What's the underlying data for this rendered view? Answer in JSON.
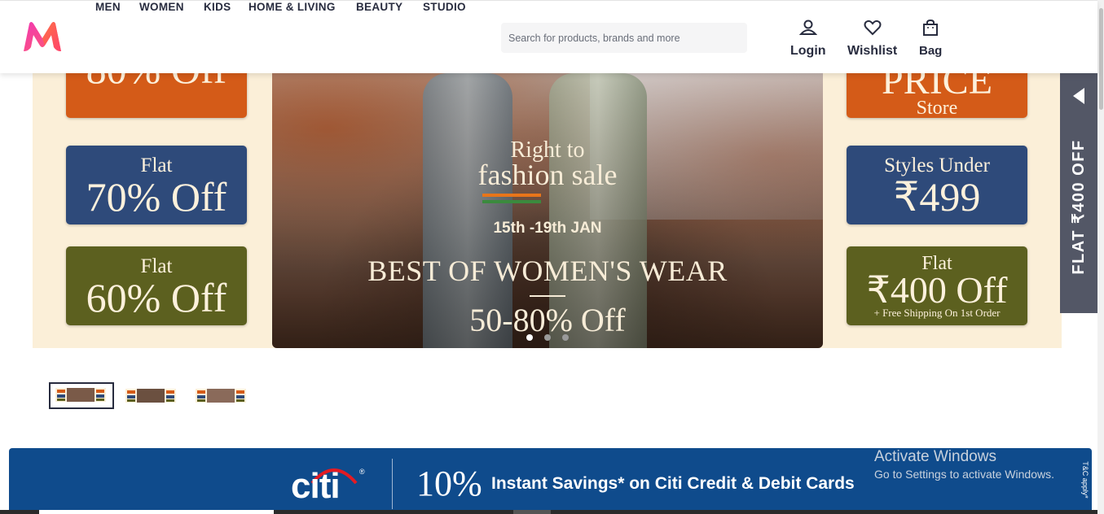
{
  "header": {
    "logo_alt": "Myntra",
    "nav": [
      "MEN",
      "WOMEN",
      "KIDS",
      "HOME & LIVING",
      "BEAUTY",
      "STUDIO"
    ],
    "search_placeholder": "Search for products, brands and more",
    "actions": {
      "login": "Login",
      "wishlist": "Wishlist",
      "bag": "Bag"
    }
  },
  "banner": {
    "left_tiles": [
      {
        "small": "",
        "big": "80% Off",
        "color": "#d45b18"
      },
      {
        "small": "Flat",
        "big": "70% Off",
        "color": "#2e4a7a"
      },
      {
        "small": "Flat",
        "big": "60% Off",
        "color": "#5c601f"
      }
    ],
    "right_tiles": [
      {
        "big": "PRICE",
        "small": "Store",
        "color": "#d45b18"
      },
      {
        "small": "Styles Under",
        "big": "₹499",
        "color": "#2e4a7a"
      },
      {
        "small": "Flat",
        "big": "₹400 Off",
        "tiny": "+ Free Shipping On 1st Order",
        "color": "#5c601f"
      }
    ],
    "hero": {
      "line1": "Right to",
      "line2": "fashion sale",
      "dates": "15th -19th JAN",
      "headline": "BEST OF WOMEN'S WEAR",
      "offer": "50-80% Off"
    },
    "slide_count": 3,
    "active_slide": 1
  },
  "side_tab": {
    "text": "FLAT ₹400 OFF"
  },
  "thumbnails": 3,
  "citi_banner": {
    "brand": "citi",
    "percent": "10%",
    "text": "Instant Savings* on Citi Credit & Debit Cards",
    "tc": "T&C apply*"
  },
  "watermark": {
    "line1": "Activate Windows",
    "line2": "Go to Settings to activate Windows."
  },
  "colors": {
    "brand_pink": "#ff3f6c",
    "brand_orange": "#f13ab1",
    "text_dark": "#282c3f",
    "citi_blue": "#0f4b8c"
  }
}
